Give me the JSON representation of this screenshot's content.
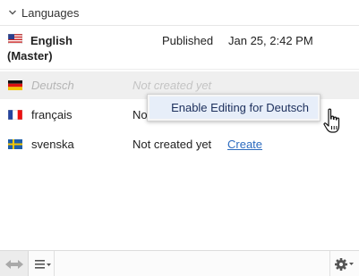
{
  "section": {
    "title": "Languages"
  },
  "languages": [
    {
      "flag": "us",
      "name_line1": "English",
      "name_line2": "(Master)",
      "status": "Published",
      "date": "Jan 25, 2:42 PM"
    },
    {
      "flag": "de",
      "name": "Deutsch",
      "status": "Not created yet"
    },
    {
      "flag": "fr",
      "name": "français",
      "status": "No"
    },
    {
      "flag": "se",
      "name": "svenska",
      "status": "Not created yet",
      "action": "Create"
    }
  ],
  "context_menu": {
    "item": "Enable Editing for Deutsch"
  },
  "footer": {
    "buttons": [
      "swap-arrows-icon",
      "list-menu-icon",
      "gear-icon"
    ]
  },
  "colors": {
    "link": "#2c6bbf",
    "menu_highlight": "#e7eef9",
    "disabled_row": "#efefef"
  }
}
